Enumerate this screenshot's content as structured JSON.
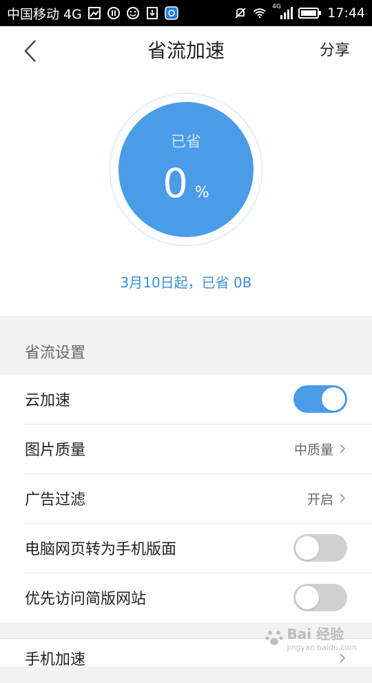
{
  "status_bar": {
    "carrier": "中国移动 4G",
    "network_label": "4G",
    "time": "17:44"
  },
  "header": {
    "title": "省流加速",
    "share_label": "分享"
  },
  "summary": {
    "saved_label": "已省",
    "percent_value": "0",
    "percent_sign": "%",
    "since_text": "3月10日起，已省 0B"
  },
  "settings": {
    "section_title": "省流设置",
    "items": [
      {
        "label": "云加速",
        "type": "toggle",
        "state": "on"
      },
      {
        "label": "图片质量",
        "type": "select",
        "value": "中质量"
      },
      {
        "label": "广告过滤",
        "type": "select",
        "value": "开启"
      },
      {
        "label": "电脑网页转为手机版面",
        "type": "toggle",
        "state": "off"
      },
      {
        "label": "优先访问简版网站",
        "type": "toggle",
        "state": "off"
      }
    ]
  },
  "next_section": {
    "first_item_label": "手机加速"
  },
  "watermark": {
    "brand": "Bai 经验",
    "url": "jingyan.baidu.com"
  },
  "colors": {
    "accent": "#4a9be8",
    "link_text": "#3d8fd6",
    "toggle_off": "#d0d0d0"
  }
}
